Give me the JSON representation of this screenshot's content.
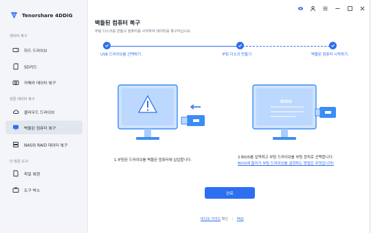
{
  "app": {
    "name": "Tenorshare 4DDiG"
  },
  "sidebar": {
    "sections": [
      {
        "label": "데이터 복구",
        "items": [
          {
            "label": "하드 드라이브",
            "icon": "hard-drive-icon"
          },
          {
            "label": "SD카드",
            "icon": "sd-card-icon"
          },
          {
            "label": "카메라 데이터 복구",
            "icon": "camera-icon"
          }
        ]
      },
      {
        "label": "전문 데이터 복구",
        "items": [
          {
            "label": "클라우드 드라이브",
            "icon": "cloud-icon"
          },
          {
            "label": "벽돌된 컴퓨터 복구",
            "icon": "computer-icon",
            "active": true
          },
          {
            "label": "NAS와 RAID 데이터 복구",
            "icon": "nas-icon"
          }
        ]
      },
      {
        "label": "더 많은 도구",
        "items": [
          {
            "label": "파일 복원",
            "icon": "file-repair-icon"
          },
          {
            "label": "도구 박스",
            "icon": "toolbox-icon"
          }
        ]
      }
    ]
  },
  "main": {
    "title": "벽돌된 컴퓨터 복구",
    "subtitle": "부팅 디스크를 만들고 컴퓨터를 시작하여 데이터를 복구하십시오.",
    "steps": [
      {
        "label": "USB 드라이브를 선택하기."
      },
      {
        "label": "부팅 디스크 만들기"
      },
      {
        "label": "벽돌된 컴퓨터 시작하기."
      }
    ],
    "left_desc": "1.부팅된 드라이브를 벽돌된 컴퓨터에 삽입합니다.",
    "right_desc_prefix": "2.BIOS를 입력하고 부팅 드라이브를 부팅 장치로 선택합니다. ",
    "right_desc_link": "BIOS에 들어가 부팅 드라이브를 설정하는 방법은 무엇입니까?",
    "bios_label": "BIOS",
    "finish_button": "완료",
    "footer": {
      "guide_link": "비디오 가이드",
      "guide_suffix": "확인",
      "faq_link": "FAQ"
    }
  },
  "colors": {
    "accent": "#2e6ef0",
    "sidebar_bg": "#f3f5f8",
    "active_bg": "#e2e6ee"
  }
}
